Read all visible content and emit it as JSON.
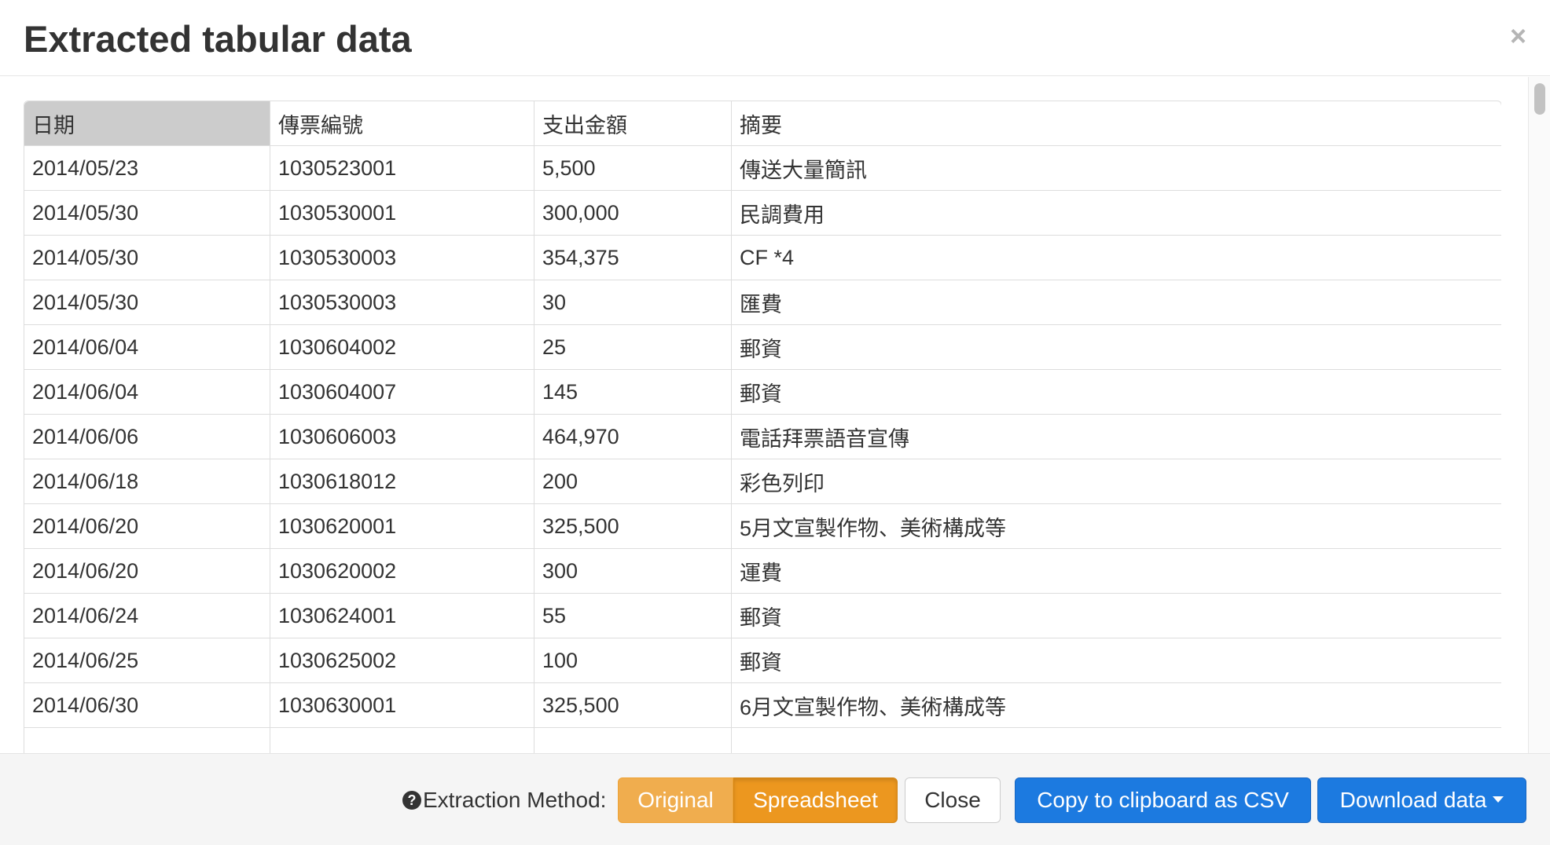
{
  "modal": {
    "title": "Extracted tabular data",
    "close_glyph": "×"
  },
  "table": {
    "headers": [
      "日期",
      "傳票編號",
      "支出金額",
      "摘要"
    ],
    "rows": [
      [
        "2014/05/23",
        "1030523001",
        "5,500",
        "傳送大量簡訊"
      ],
      [
        "2014/05/30",
        "1030530001",
        "300,000",
        "民調費用"
      ],
      [
        "2014/05/30",
        "1030530003",
        "354,375",
        "CF *4"
      ],
      [
        "2014/05/30",
        "1030530003",
        "30",
        "匯費"
      ],
      [
        "2014/06/04",
        "1030604002",
        "25",
        "郵資"
      ],
      [
        "2014/06/04",
        "1030604007",
        "145",
        "郵資"
      ],
      [
        "2014/06/06",
        "1030606003",
        "464,970",
        "電話拜票語音宣傳"
      ],
      [
        "2014/06/18",
        "1030618012",
        "200",
        "彩色列印"
      ],
      [
        "2014/06/20",
        "1030620001",
        "325,500",
        "5月文宣製作物、美術構成等"
      ],
      [
        "2014/06/20",
        "1030620002",
        "300",
        "運費"
      ],
      [
        "2014/06/24",
        "1030624001",
        "55",
        "郵資"
      ],
      [
        "2014/06/25",
        "1030625002",
        "100",
        "郵資"
      ],
      [
        "2014/06/30",
        "1030630001",
        "325,500",
        "6月文宣製作物、美術構成等"
      ]
    ]
  },
  "footer": {
    "help_glyph": "?",
    "extraction_label": "Extraction Method:",
    "method_original": "Original",
    "method_spreadsheet": "Spreadsheet",
    "close_label": "Close",
    "copy_label": "Copy to clipboard as CSV",
    "download_label": "Download data"
  },
  "colors": {
    "orange": "#f0ad4e",
    "orange_active": "#ec971f",
    "blue": "#1c7ae0",
    "header_selected": "#cccccc"
  },
  "icons": {
    "help": "question-circle-icon",
    "close": "close-icon",
    "dropdown": "caret-down-icon"
  }
}
